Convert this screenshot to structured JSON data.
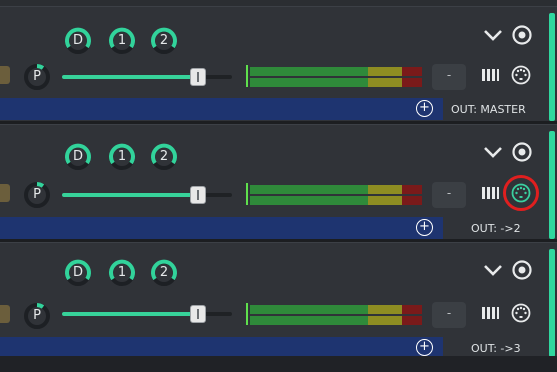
{
  "strips": [
    {
      "knobs": [
        "D",
        "1",
        "2"
      ],
      "pan_label": "P",
      "fader_mute_label": "-",
      "output_label": "OUT: MASTER",
      "routing_add_label": "+",
      "midi_highlighted": false
    },
    {
      "knobs": [
        "D",
        "1",
        "2"
      ],
      "pan_label": "P",
      "fader_mute_label": "-",
      "output_label": "OUT: ->2",
      "routing_add_label": "+",
      "midi_highlighted": true
    },
    {
      "knobs": [
        "D",
        "1",
        "2"
      ],
      "pan_label": "P",
      "fader_mute_label": "-",
      "output_label": "OUT: ->3",
      "routing_add_label": "+",
      "midi_highlighted": false
    }
  ],
  "colors": {
    "accent": "#2fd79e",
    "routing_bar": "#1e3470",
    "highlight_ring": "#e01f1f"
  },
  "icons": {
    "collapse": "chevron-down-icon",
    "settings": "target-icon",
    "keyboard": "piano-keys-icon",
    "midi": "midi-port-icon",
    "add": "plus-circle-icon"
  }
}
